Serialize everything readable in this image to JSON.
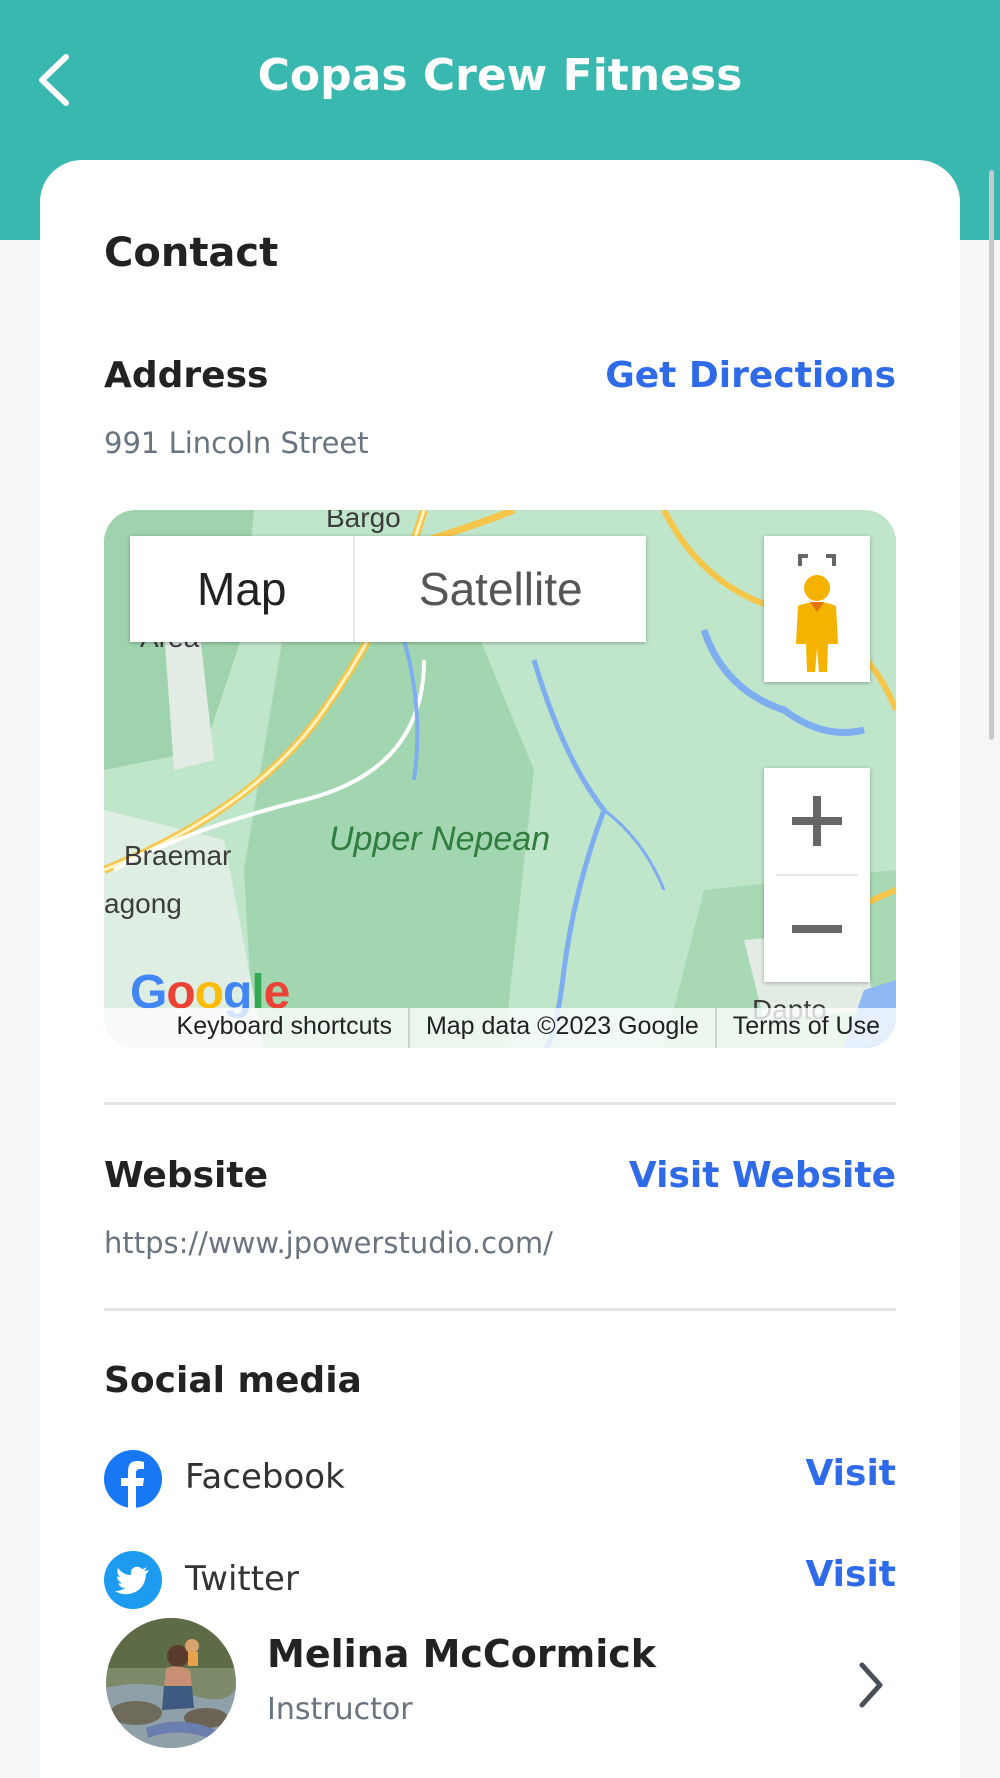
{
  "header": {
    "title": "Copas Crew Fitness",
    "background_color": "#38b8ae"
  },
  "contact": {
    "section_title": "Contact",
    "address": {
      "label": "Address",
      "link": "Get Directions",
      "value": "991 Lincoln Street"
    },
    "map": {
      "type_map": "Map",
      "type_satellite": "Satellite",
      "place_labels": [
        "Bargo",
        "Area",
        "Braemar",
        "agong",
        "Upper Nepean",
        "Dapto"
      ],
      "logo": "Google",
      "attribution": [
        "Keyboard shortcuts",
        "Map data ©2023 Google",
        "Terms of Use"
      ]
    },
    "website": {
      "label": "Website",
      "link": "Visit Website",
      "value": "https://www.jpowerstudio.com/"
    },
    "social": {
      "title": "Social media",
      "items": [
        {
          "name": "Facebook",
          "link": "Visit",
          "icon": "facebook-icon"
        },
        {
          "name": "Twitter",
          "link": "Visit",
          "icon": "twitter-icon"
        }
      ]
    }
  },
  "instructor": {
    "name": "Melina McCormick",
    "role": "Instructor"
  },
  "colors": {
    "accent": "#2f6be8",
    "facebook": "#1877f2",
    "twitter": "#1d9bf0"
  }
}
